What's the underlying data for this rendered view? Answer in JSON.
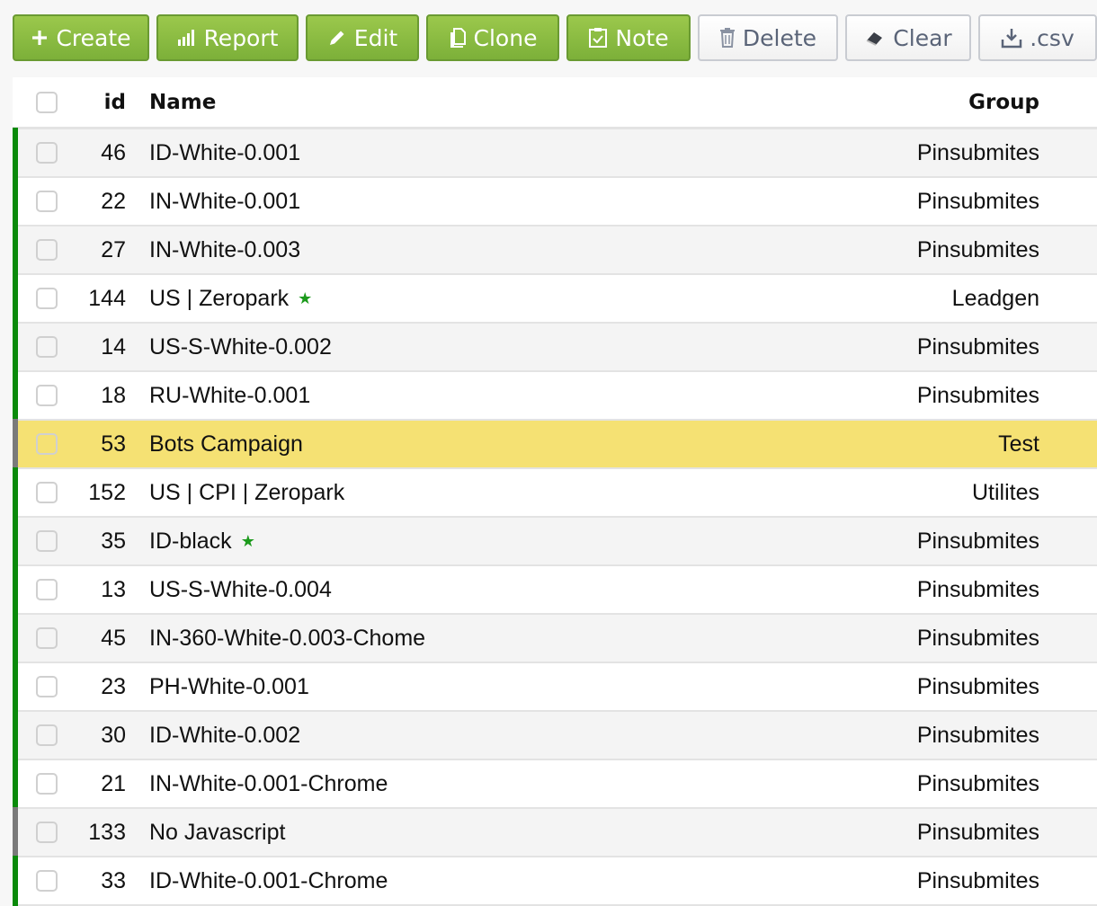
{
  "toolbar": {
    "buttons": [
      {
        "label": "Create",
        "icon": "plus-icon",
        "style": "green"
      },
      {
        "label": "Report",
        "icon": "bar-chart-icon",
        "style": "green"
      },
      {
        "label": "Edit",
        "icon": "pencil-icon",
        "style": "green"
      },
      {
        "label": "Clone",
        "icon": "copy-icon",
        "style": "green"
      },
      {
        "label": "Note",
        "icon": "clipboard-check-icon",
        "style": "green"
      },
      {
        "label": "Delete",
        "icon": "trash-icon",
        "style": "white"
      },
      {
        "label": "Clear",
        "icon": "eraser-icon",
        "style": "white"
      },
      {
        "label": ".csv",
        "icon": "download-icon",
        "style": "white"
      }
    ]
  },
  "colors": {
    "active": "#0a8a0a",
    "inactive": "#7a7a7a",
    "highlight": "#f5e173",
    "star": "#1c9a1c"
  },
  "table": {
    "headers": {
      "id": "id",
      "name": "Name",
      "group": "Group"
    },
    "rows": [
      {
        "id": "46",
        "name": "ID-White-0.001",
        "group": "Pinsubmites",
        "status": "active",
        "starred": false,
        "highlighted": false
      },
      {
        "id": "22",
        "name": "IN-White-0.001",
        "group": "Pinsubmites",
        "status": "active",
        "starred": false,
        "highlighted": false
      },
      {
        "id": "27",
        "name": "IN-White-0.003",
        "group": "Pinsubmites",
        "status": "active",
        "starred": false,
        "highlighted": false
      },
      {
        "id": "144",
        "name": "US | Zeropark",
        "group": "Leadgen",
        "status": "active",
        "starred": true,
        "highlighted": false
      },
      {
        "id": "14",
        "name": "US-S-White-0.002",
        "group": "Pinsubmites",
        "status": "active",
        "starred": false,
        "highlighted": false
      },
      {
        "id": "18",
        "name": "RU-White-0.001",
        "group": "Pinsubmites",
        "status": "active",
        "starred": false,
        "highlighted": false
      },
      {
        "id": "53",
        "name": "Bots Campaign",
        "group": "Test",
        "status": "inactive",
        "starred": false,
        "highlighted": true
      },
      {
        "id": "152",
        "name": "US | CPI | Zeropark",
        "group": "Utilites",
        "status": "active",
        "starred": false,
        "highlighted": false
      },
      {
        "id": "35",
        "name": "ID-black",
        "group": "Pinsubmites",
        "status": "active",
        "starred": true,
        "highlighted": false
      },
      {
        "id": "13",
        "name": "US-S-White-0.004",
        "group": "Pinsubmites",
        "status": "active",
        "starred": false,
        "highlighted": false
      },
      {
        "id": "45",
        "name": "IN-360-White-0.003-Chome",
        "group": "Pinsubmites",
        "status": "active",
        "starred": false,
        "highlighted": false
      },
      {
        "id": "23",
        "name": "PH-White-0.001",
        "group": "Pinsubmites",
        "status": "active",
        "starred": false,
        "highlighted": false
      },
      {
        "id": "30",
        "name": "ID-White-0.002",
        "group": "Pinsubmites",
        "status": "active",
        "starred": false,
        "highlighted": false
      },
      {
        "id": "21",
        "name": "IN-White-0.001-Chrome",
        "group": "Pinsubmites",
        "status": "active",
        "starred": false,
        "highlighted": false
      },
      {
        "id": "133",
        "name": "No Javascript",
        "group": "Pinsubmites",
        "status": "inactive",
        "starred": false,
        "highlighted": false
      },
      {
        "id": "33",
        "name": "ID-White-0.001-Chrome",
        "group": "Pinsubmites",
        "status": "active",
        "starred": false,
        "highlighted": false
      }
    ]
  }
}
